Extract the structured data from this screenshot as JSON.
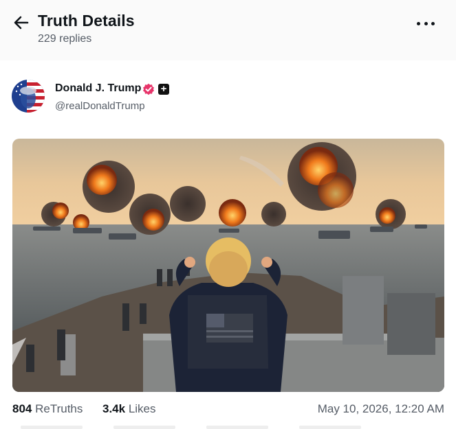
{
  "header": {
    "title": "Truth Details",
    "replies_label": "229 replies"
  },
  "post": {
    "author_name": "Donald J. Trump",
    "author_handle": "@realDonaldTrump",
    "image_icon": "photo-warships-explosions",
    "retruths_count": "804",
    "retruths_label": "ReTruths",
    "likes_count": "3.4k",
    "likes_label": "Likes",
    "timestamp": "May 10, 2026, 12:20 AM"
  },
  "colors": {
    "verified": "#e7346a",
    "text_primary": "#0f1419",
    "text_secondary": "#555c66",
    "header_bg": "#fafafa"
  }
}
